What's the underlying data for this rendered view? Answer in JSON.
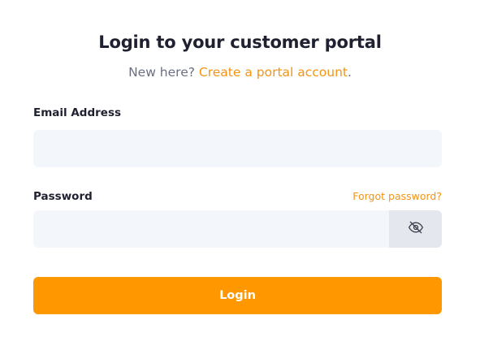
{
  "header": {
    "title": "Login to your customer portal",
    "subtitle_prefix": "New here?",
    "create_account_link": "Create a portal account",
    "subtitle_suffix": "."
  },
  "form": {
    "email_label": "Email Address",
    "email_value": "",
    "password_label": "Password",
    "password_value": "",
    "forgot_link": "Forgot password?",
    "toggle_visibility_icon": "eye-off-icon",
    "submit_label": "Login"
  },
  "colors": {
    "accent": "#fe9700",
    "link": "#f39414",
    "field_bg": "#f3f6fa",
    "toggle_bg": "#e4e7ee",
    "text": "#1f2130",
    "muted": "#6b6f80"
  }
}
